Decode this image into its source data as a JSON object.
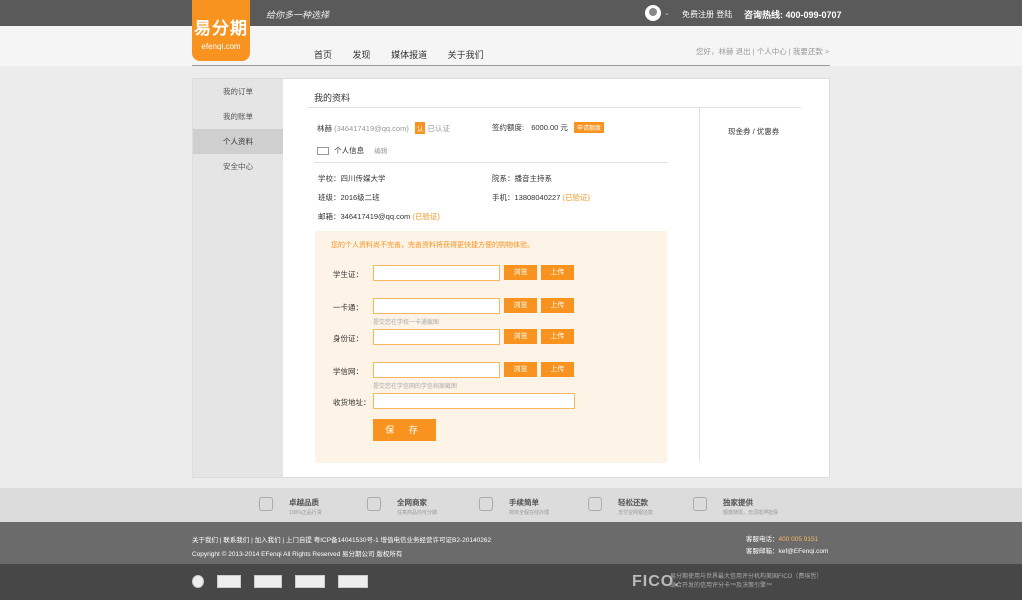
{
  "header": {
    "logo_main": "易分期",
    "logo_sub": "efenqi.com",
    "slogan": "给你多一种选择",
    "register": "免费注册",
    "login": "登陆",
    "hotline": "咨询热线: 400-099-0707"
  },
  "nav": {
    "items": [
      "首页",
      "发现",
      "媒体报道",
      "关于我们"
    ],
    "user_links": "您好，林赫 退出 | 个人中心 | 我要还款 >"
  },
  "sidebar": {
    "items": [
      "我的订单",
      "我的账单",
      "个人资料",
      "安全中心"
    ],
    "active": "个人资料"
  },
  "profile": {
    "title": "我的资料",
    "name": "林赫",
    "qq": "(346417419@qq.com)",
    "verified_badge": "认",
    "verified_text": "已认证",
    "credit_label": "签约额度:",
    "credit_value": "6000.00 元",
    "apply_button": "申请额度",
    "info_title": "个人信息",
    "edit": "编辑",
    "school_label": "学校：",
    "school": "四川传媒大学",
    "college_label": "院系：",
    "college": "播音主持系",
    "class_label": "班级：",
    "class_name": "2016级二班",
    "phone_label": "手机：",
    "phone": "13808040227",
    "phone_status": "(已验证)",
    "email_label": "邮箱：",
    "email": "346417419@qq.com",
    "email_status": "(已验证)"
  },
  "form": {
    "notice": "您的个人资料尚不完善，完善资料将获得更快捷方便的购物体验。",
    "student_card": "学生证：",
    "campus_card": "一卡通：",
    "campus_hint": "提交您在学校一卡通截图",
    "id_card": "身份证：",
    "xuexin": "学信网：",
    "xuexin_hint": "提交您在学信网的学信档案截图",
    "address": "收货地址：",
    "browse": "浏览",
    "upload": "上传",
    "save": "保 存"
  },
  "right": {
    "coupon": "现金券 / 优惠券"
  },
  "features": [
    {
      "title": "卓越品质",
      "sub": "100%正品行货"
    },
    {
      "title": "全网商家",
      "sub": "任意商品均可分期"
    },
    {
      "title": "手续简单",
      "sub": "简单全程在线办理"
    },
    {
      "title": "轻松还款",
      "sub": "支付宝网银还款"
    },
    {
      "title": "独家提供",
      "sub": "额度随需，无须抵押担保"
    }
  ],
  "footer": {
    "links": "关于我们  |  联系我们  |  加入我们  |  上门自提    粤ICP备14041530号-1    增值电信业务经营许可证B2-20140262",
    "copyright": "Copyright © 2013-2014 EFenqi All Rights Reserved 易分期公司 版权所有",
    "service_phone_label": "客服电话：",
    "service_phone": "400 005 9151",
    "service_email_label": "客服邮箱：",
    "service_email": "kef@EFenqi.com",
    "fico": "FICO.",
    "fico_text_1": "易分期使用与世界最大信用评分机构美国FICO（费埃哲）",
    "fico_text_2": "联合开发的信用评分卡™及决策引擎™"
  },
  "colors": {
    "accent": "#f7931e",
    "topbar": "#5a5a5a",
    "footer": "#6b6b6b",
    "footer_dark": "#474747"
  }
}
